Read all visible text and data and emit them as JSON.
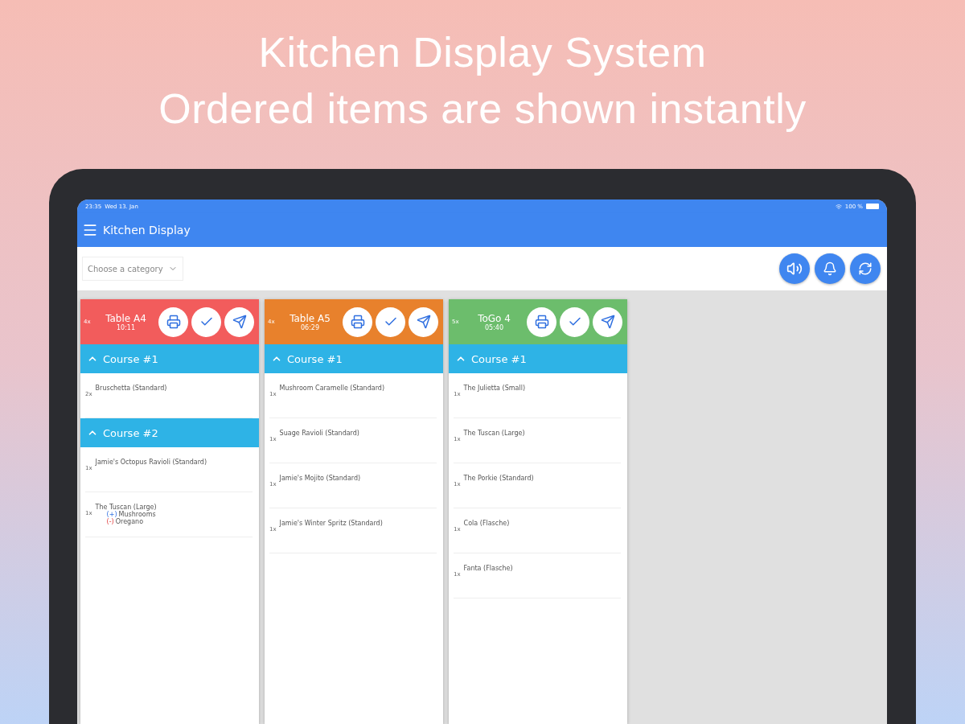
{
  "headline": [
    "Kitchen Display System",
    "Ordered items are shown instantly"
  ],
  "status_bar": {
    "time": "23:35",
    "date": "Wed 13. Jan",
    "battery": "100 %"
  },
  "app_bar": {
    "title": "Kitchen Display"
  },
  "category_select": {
    "placeholder": "Choose a category"
  },
  "toolbar_buttons": [
    {
      "kind": "sound"
    },
    {
      "kind": "bell"
    },
    {
      "kind": "refresh"
    }
  ],
  "orders": [
    {
      "count": "4x",
      "name": "Table A4",
      "time": "10:11",
      "color": "#f25c5c",
      "courses": [
        {
          "title": "Course #1",
          "expanded": true,
          "items": [
            {
              "qty": "2x",
              "name": "Bruschetta (Standard)"
            }
          ]
        },
        {
          "title": "Course #2",
          "expanded": true,
          "items": [
            {
              "qty": "1x",
              "name": "Jamie's Octopus Ravioli (Standard)"
            },
            {
              "qty": "1x",
              "name": "The Tuscan (Large)",
              "modifiers": [
                {
                  "kind": "add",
                  "sign": "(+)",
                  "label": "Mushrooms"
                },
                {
                  "kind": "remove",
                  "sign": "(-)",
                  "label": "Oregano"
                }
              ]
            }
          ]
        }
      ]
    },
    {
      "count": "4x",
      "name": "Table A5",
      "time": "06:29",
      "color": "#e8812c",
      "courses": [
        {
          "title": "Course #1",
          "expanded": true,
          "items": [
            {
              "qty": "1x",
              "name": "Mushroom Caramelle (Standard)"
            },
            {
              "qty": "1x",
              "name": "Suage Ravioli (Standard)"
            },
            {
              "qty": "1x",
              "name": "Jamie's Mojito (Standard)"
            },
            {
              "qty": "1x",
              "name": "Jamie's Winter Spritz (Standard)"
            }
          ]
        }
      ]
    },
    {
      "count": "5x",
      "name": "ToGo 4",
      "time": "05:40",
      "color": "#6cbd6c",
      "courses": [
        {
          "title": "Course #1",
          "expanded": true,
          "items": [
            {
              "qty": "1x",
              "name": "The Julietta (Small)"
            },
            {
              "qty": "1x",
              "name": "The Tuscan (Large)"
            },
            {
              "qty": "1x",
              "name": "The Porkie (Standard)"
            },
            {
              "qty": "1x",
              "name": "Cola (Flasche)"
            },
            {
              "qty": "1x",
              "name": "Fanta (Flasche)"
            }
          ]
        }
      ]
    }
  ]
}
